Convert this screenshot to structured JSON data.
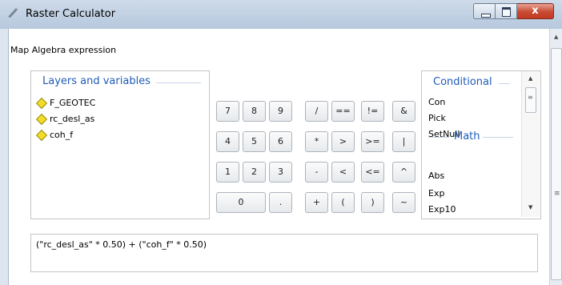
{
  "window": {
    "title": "Raster Calculator",
    "close_glyph": "x"
  },
  "map_algebra_label": "Map Algebra expression",
  "layers": {
    "title": "Layers and variables",
    "items": [
      "F_GEOTEC",
      "rc_desl_as",
      "coh_f"
    ]
  },
  "keypad": {
    "keys": [
      "7",
      "8",
      "9",
      "/",
      "==",
      "!=",
      "&",
      "4",
      "5",
      "6",
      "*",
      ">",
      ">=",
      "|",
      "1",
      "2",
      "3",
      "-",
      "<",
      "<=",
      "^",
      "0",
      ".",
      "+",
      "(",
      ")",
      "~"
    ]
  },
  "functions": {
    "conditional_title": "Conditional",
    "conditional": [
      "Con",
      "Pick",
      "SetNull"
    ],
    "math_title": "Math",
    "math": [
      "Abs",
      "Exp",
      "Exp10"
    ]
  },
  "expression": "(\"rc_desl_as\" * 0.50) + (\"coh_f\" * 0.50)",
  "colors": {
    "accent_blue": "#1f5cb8",
    "close_red": "#c74a32",
    "layer_diamond": "#f1dd29"
  }
}
